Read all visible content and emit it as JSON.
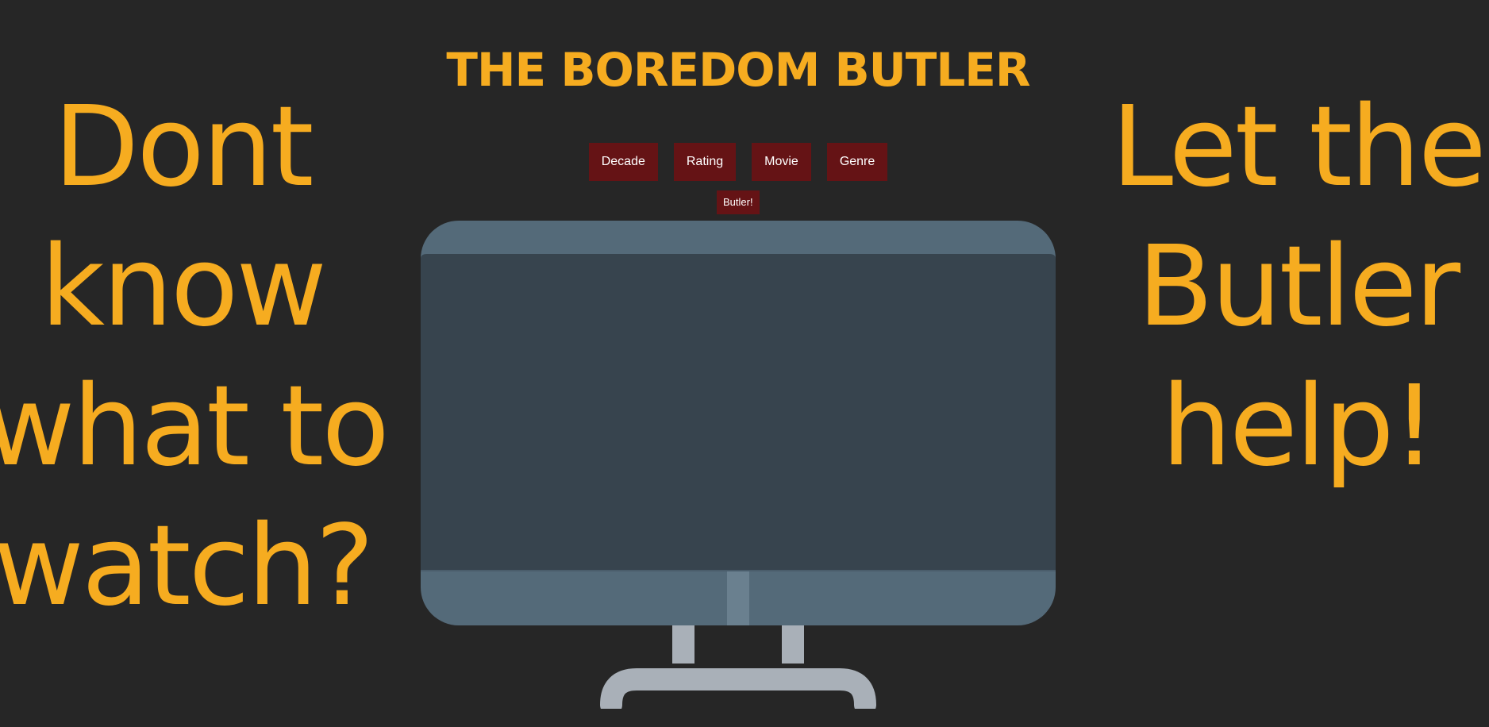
{
  "header": {
    "title": "THE BOREDOM BUTLER"
  },
  "left_text": [
    "Dont",
    "know",
    "what to",
    "watch?"
  ],
  "right_text": [
    "Let the",
    "Butler",
    "help!"
  ],
  "menu": {
    "decade": "Decade",
    "rating": "Rating",
    "movie": "Movie",
    "genre": "Genre",
    "butler": "Butler!"
  },
  "colors": {
    "background": "#262626",
    "accent": "#f6ac20",
    "button": "#651315",
    "tv_frame": "#546a79",
    "tv_screen": "#37444e",
    "tv_stand": "#a9b0b8"
  },
  "icons": {
    "tv": "television-icon"
  }
}
